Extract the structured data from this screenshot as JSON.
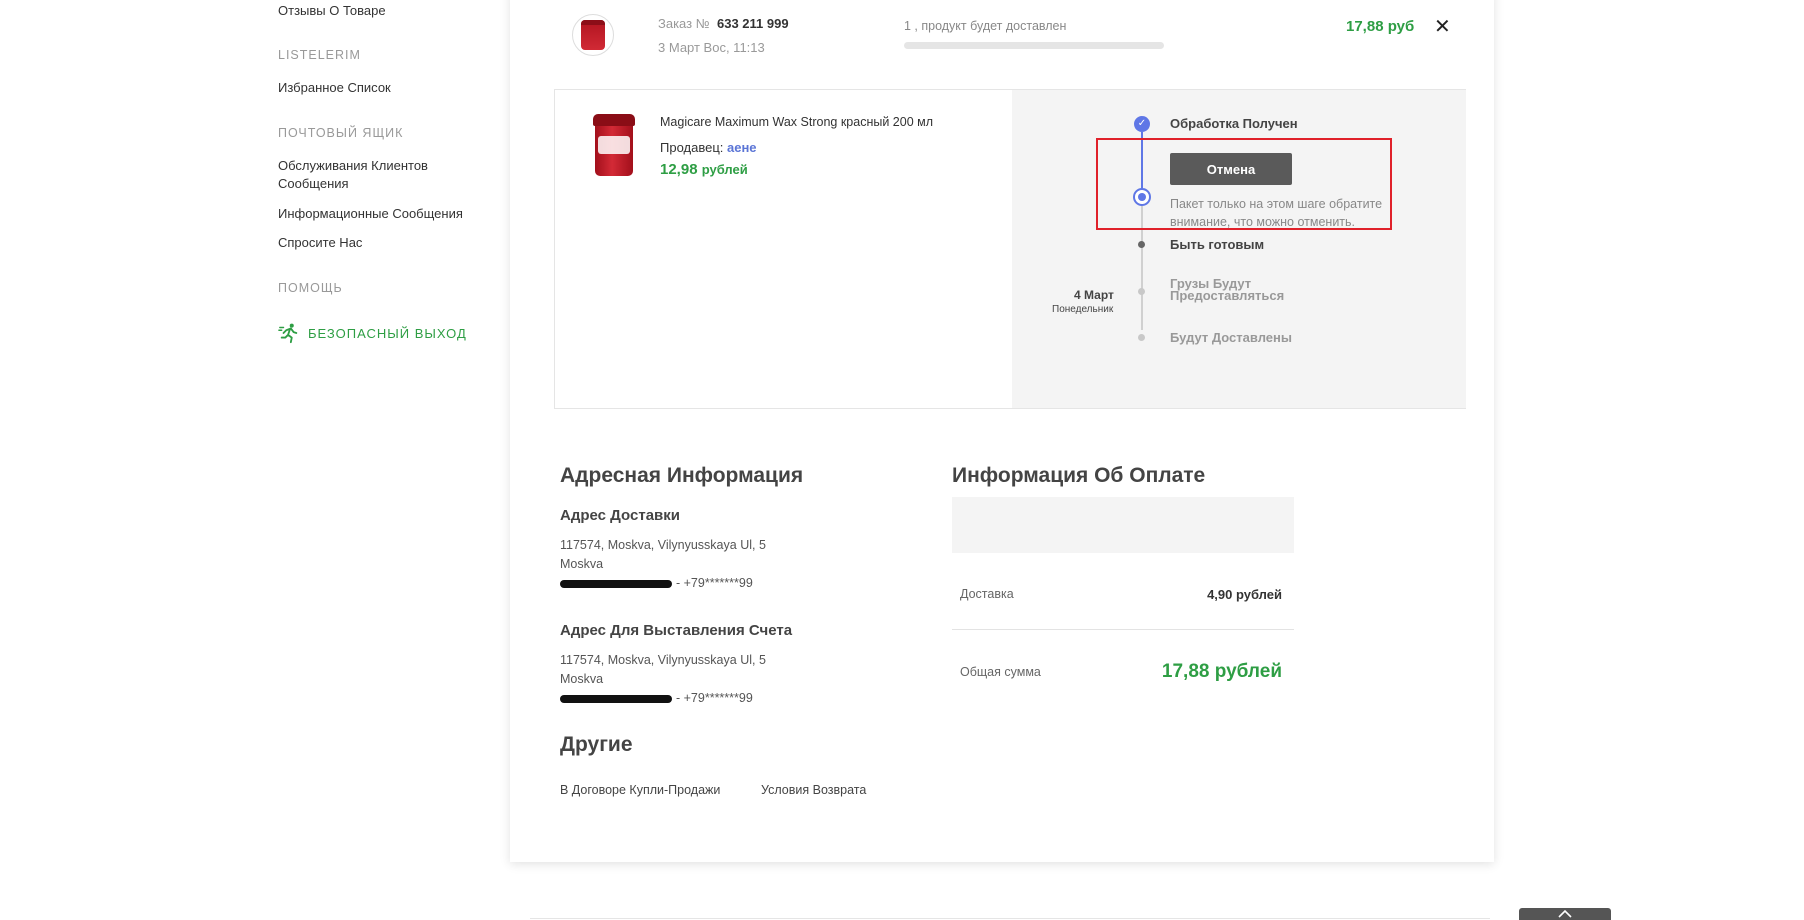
{
  "sidebar": {
    "reviews_link": "Отзывы О Товаре",
    "lists_heading": "LISTELERIM",
    "favorites_link": "Избранное Список",
    "mailbox_heading": "ПОЧТОВЫЙ ЯЩИК",
    "customer_service_link_1": "Обслуживания Клиентов",
    "customer_service_link_2": "Сообщения",
    "info_messages_link": "Информационные Сообщения",
    "ask_us_link": "Спросите Нас",
    "help_heading": "ПОМОЩЬ",
    "logout_label": "БЕЗОПАСНЫЙ ВЫХОД"
  },
  "order": {
    "number_label": "Заказ №",
    "number": "633 211 999",
    "date": "3 Март Вос, 11:13",
    "delivery_status": "1 , продукт будет доставлен",
    "delivery_progress": 0,
    "total": "17,88 руб",
    "close_symbol": "✕"
  },
  "product": {
    "name": "Magicare Maximum Wax Strong красный 200 мл",
    "seller_label": "Продавец:",
    "seller_name": "аене",
    "price_value": "12,98",
    "price_unit": "рублей"
  },
  "timeline": {
    "step_received": "Обработка Получен",
    "cancel_button": "Отмена",
    "cancel_note": "Пакет только на этом шаге обратите внимание, что можно отменить.",
    "step_ready": "Быть готовым",
    "eta_date": "4 Март",
    "eta_day": "Понедельник",
    "step_handover_1": "Грузы Будут",
    "step_handover_2": "Предоставляться",
    "step_delivered": "Будут Доставлены"
  },
  "address": {
    "title": "Адресная Информация",
    "shipping_title": "Адрес Доставки",
    "shipping_line1": "117574, Moskva, Vilynyusskaya Ul, 5",
    "shipping_line2": "Moskva",
    "shipping_phone": "- +79*******99",
    "billing_title": "Адрес Для Выставления Счета",
    "billing_line1": "117574, Moskva, Vilynyusskaya Ul, 5",
    "billing_line2": "Moskva",
    "billing_phone": "- +79*******99"
  },
  "payment": {
    "title": "Информация Об Оплате",
    "shipping_label": "Доставка",
    "shipping_value": "4,90 рублей",
    "total_label": "Общая сумма",
    "total_value": "17,88 рублей"
  },
  "other": {
    "title": "Другие",
    "contract_link": "В Договоре Купли-Продажи",
    "return_link": "Условия Возврата"
  },
  "colors": {
    "accent_green": "#2e9e44",
    "timeline_blue": "#5f77e6",
    "highlight_red": "#e0212a",
    "seller_blue": "#5b75d6"
  },
  "icons": {
    "logout": "running-exit-icon",
    "close": "close-icon",
    "step_done": "check-circle-icon",
    "scroll_top": "chevron-up-icon"
  }
}
